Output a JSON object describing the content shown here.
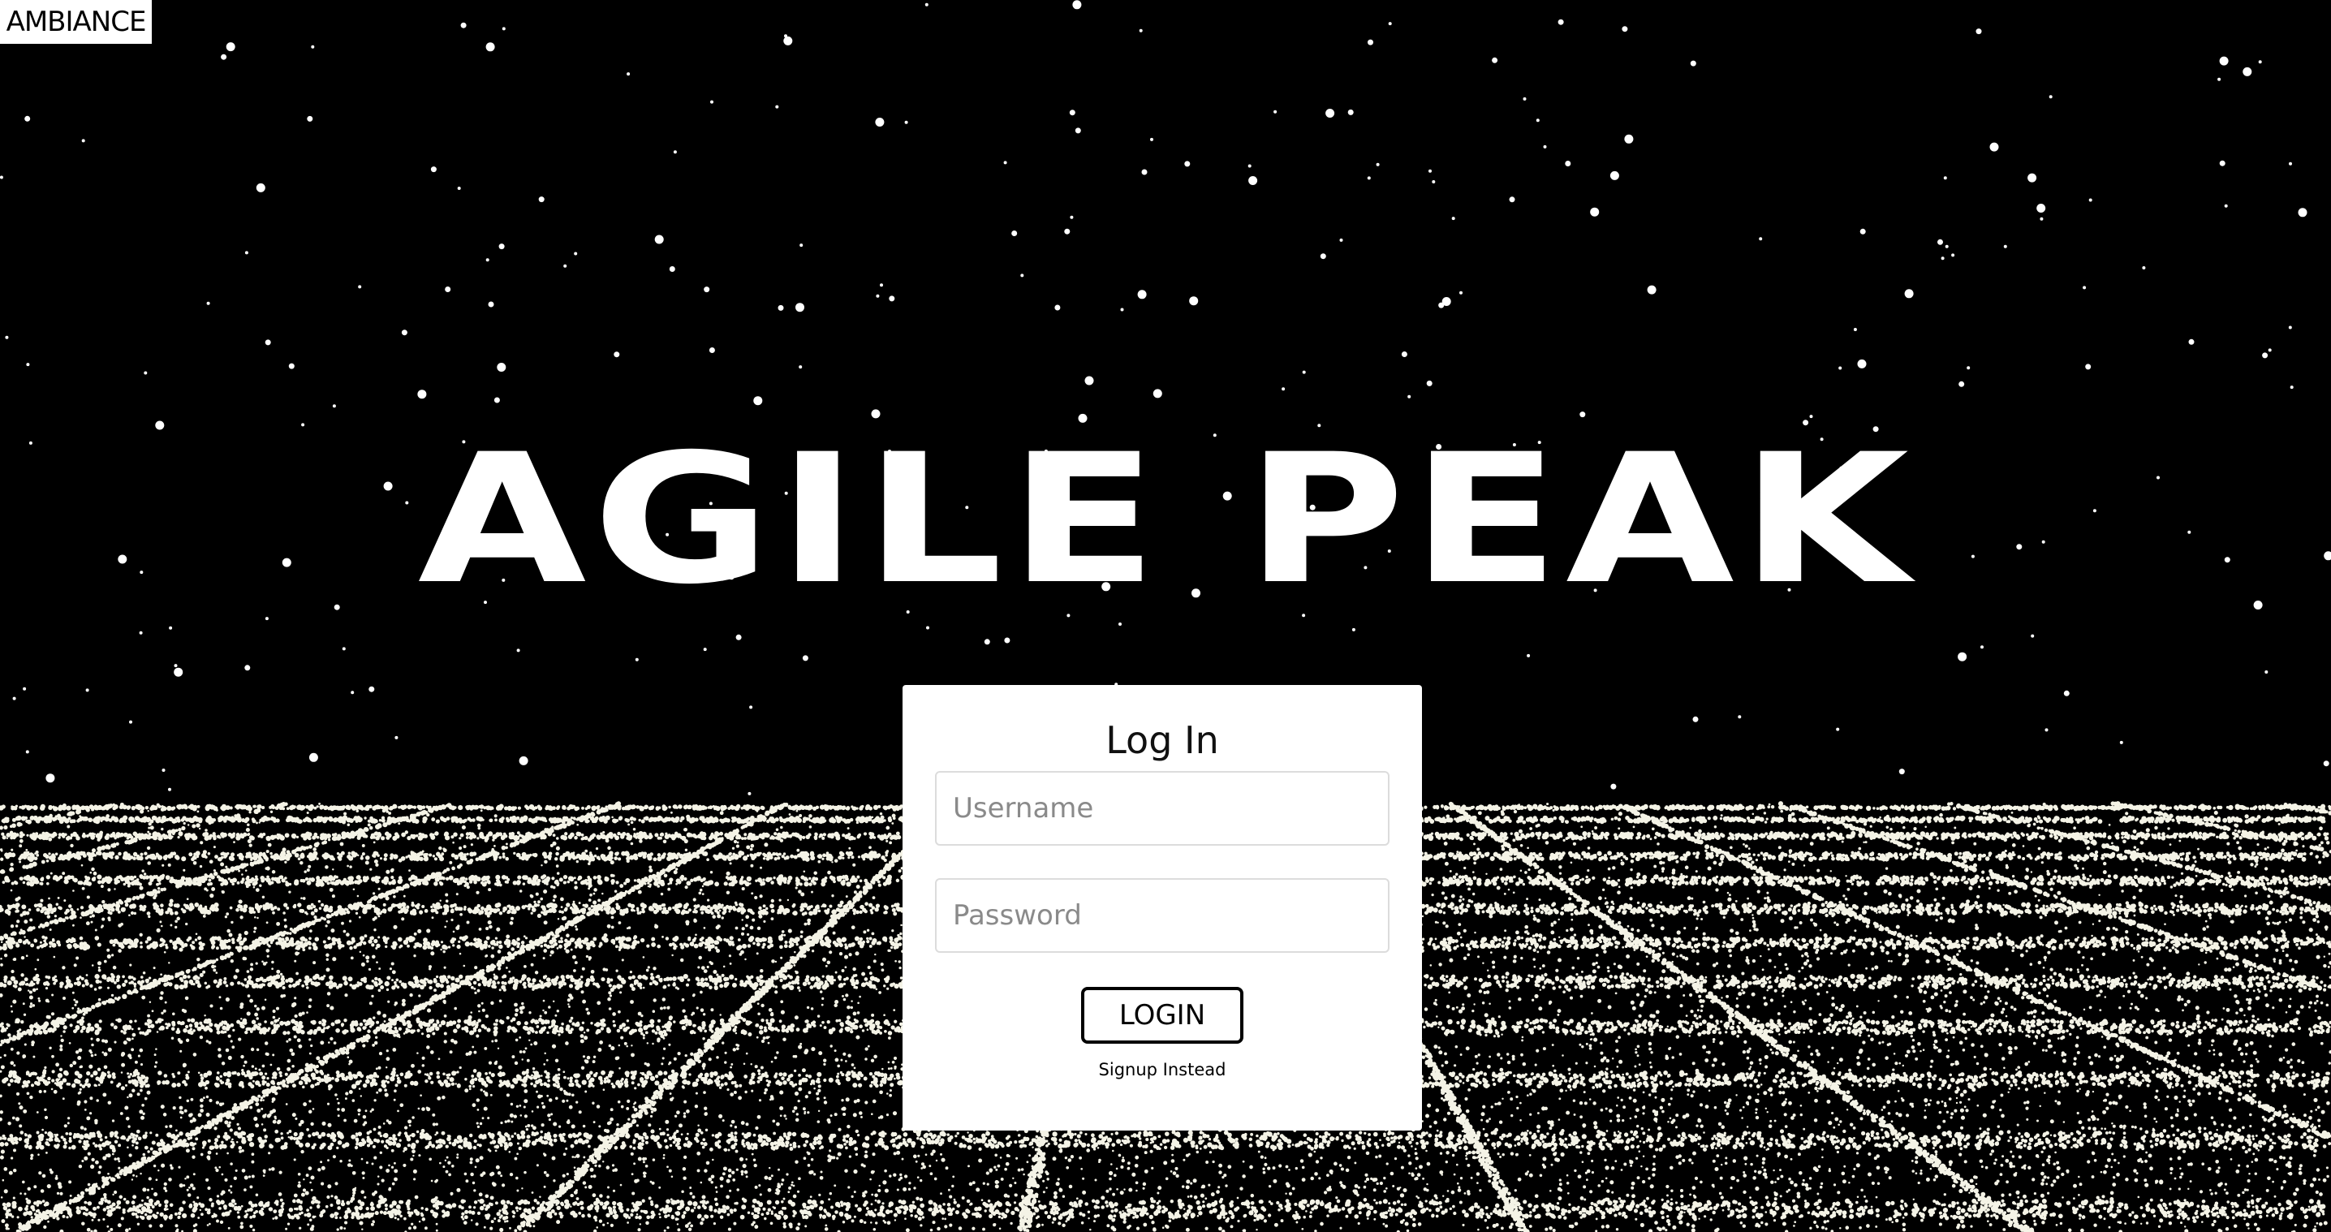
{
  "ambiance_button": {
    "label": "AMBIANCE"
  },
  "hero": {
    "title": "AGILE PEAK"
  },
  "login": {
    "heading": "Log In",
    "username": {
      "placeholder": "Username",
      "value": ""
    },
    "password": {
      "placeholder": "Password",
      "value": ""
    },
    "submit_label": "LOGIN",
    "signup_link": "Signup Instead"
  },
  "colors": {
    "background": "#000000",
    "stars": "#ffffff",
    "grid": "#f4f3e6",
    "card": "#ffffff",
    "text": "#000000"
  }
}
